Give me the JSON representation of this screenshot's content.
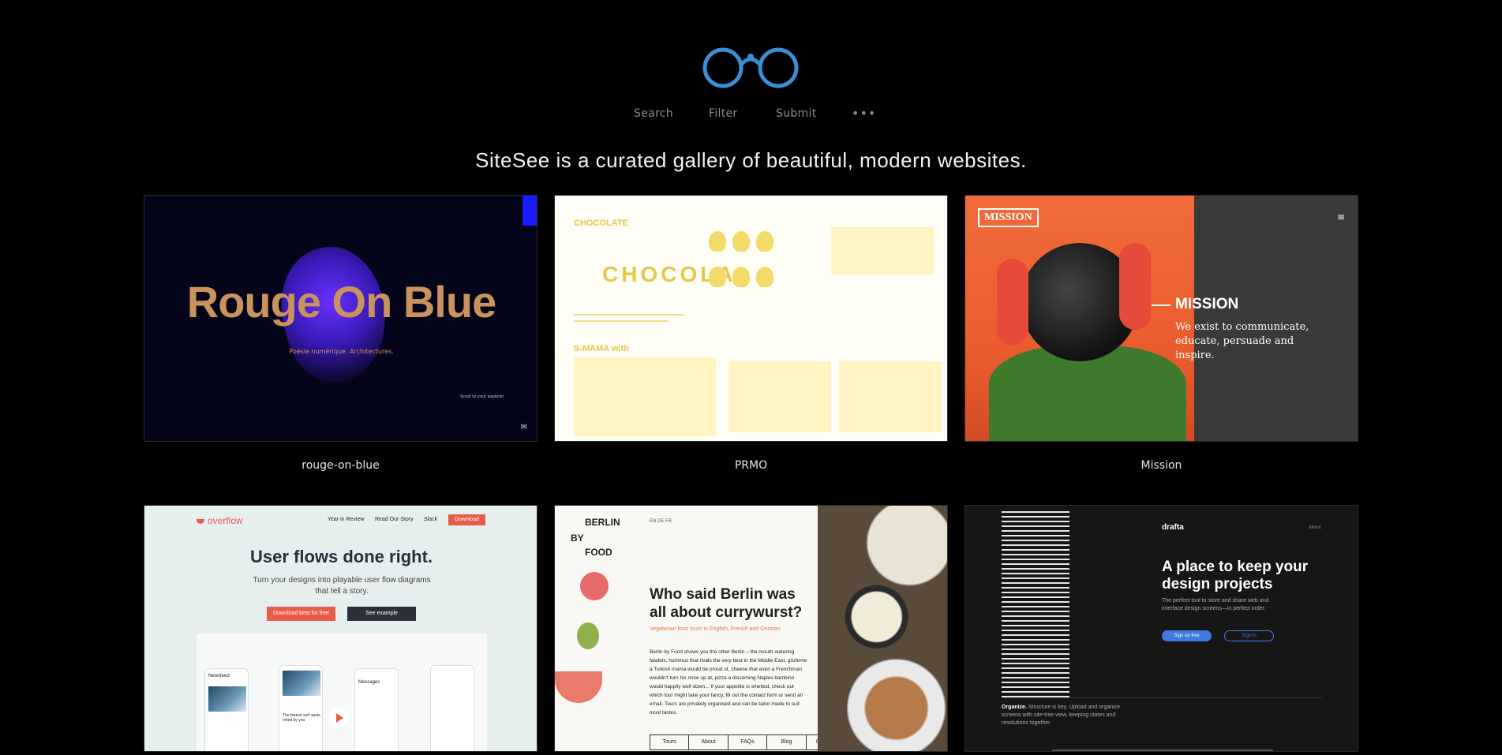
{
  "header": {
    "logo_icon": "glasses-icon",
    "accent_color": "#3a8fd6",
    "nav": [
      "Search",
      "Filter",
      "Submit"
    ],
    "more_icon": "•••",
    "tagline": "SiteSee is a curated gallery of beautiful, modern websites."
  },
  "gallery": [
    {
      "caption": "rouge-on-blue",
      "title": "Rouge On Blue",
      "subtitle": "Poésie numérique. Architectures.",
      "scroll_hint": "Scroll to your explorer"
    },
    {
      "caption": "PRMO",
      "heading": "CHOCOLATE",
      "big_text": "CHOCOLA",
      "section": "S-MAMA with"
    },
    {
      "caption": "Mission",
      "logo": "MISSION",
      "menu_icon": "≡",
      "title": "MISSION",
      "text": "We exist to communicate, educate, persuade and inspire."
    },
    {
      "caption": "",
      "brand": "overflow",
      "nav": [
        "Year in Review",
        "Read Our Story",
        "Slack"
      ],
      "download": "Download",
      "headline": "User flows done right.",
      "text": "Turn your designs into playable user flow diagrams that tell a story.",
      "cta_primary": "Download beta for free",
      "cta_secondary": "See example",
      "phone_labels": [
        "Newsfeed",
        "The fastest surf spots voted by you",
        "Messages"
      ]
    },
    {
      "caption": "",
      "logo_lines": [
        "BERLIN",
        "BY",
        "FOOD"
      ],
      "lang": "EN  DE  FR",
      "headline": "Who said Berlin was all about currywurst?",
      "sub": "Vegetarian food tours in English, French and German",
      "body": "Berlin by Food shows you the other Berlin – the mouth-watering falafels, hummus that rivals the very best in the Middle East, gözleme a Turkish mama would be proud of, cheese that even a Frenchman wouldn't turn his nose up at, pizza a discerning Naples bambino would happily wolf down... If your appetite is whetted, check out which tour might take your fancy, fill out the contact form or send an email. Tours are privately organised and can be tailor-made to suit most tastes.",
      "nav": [
        "Tours",
        "About",
        "FAQs",
        "Blog",
        "Contact"
      ]
    },
    {
      "caption": "",
      "brand": "drafta",
      "about": "About",
      "headline": "A place to keep your design projects",
      "text": "The perfect tool to store and share web and interface design screens—in perfect order.",
      "signup": "Sign up free",
      "signin": "Sign in",
      "organize_label": "Organize.",
      "organize_text": "Structure is key. Upload and organize screens with site-tree view, keeping states and resolutions together."
    }
  ]
}
